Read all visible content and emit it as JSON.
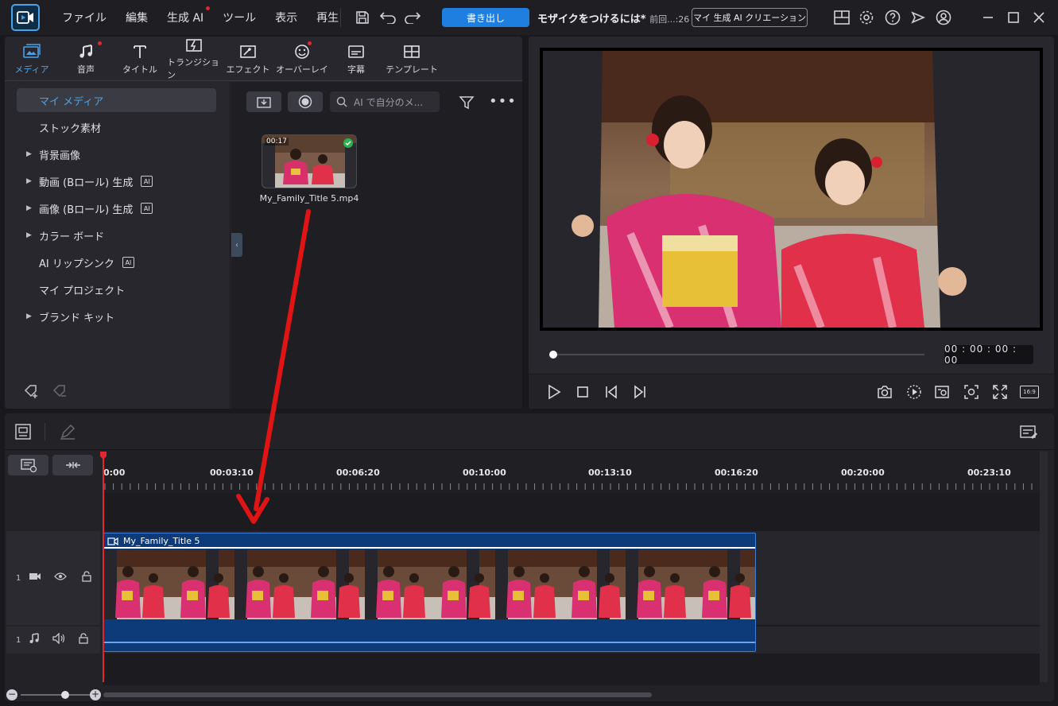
{
  "titlebar": {
    "menu": [
      "ファイル",
      "編集",
      "生成 AI",
      "ツール",
      "表示",
      "再生"
    ],
    "export_label": "書き出し",
    "project_title": "モザイクをつけるには*",
    "project_suffix": "前回...:26",
    "ai_creation_label": "マイ 生成 AI クリエーション"
  },
  "media_tabs": [
    {
      "label": "メディア",
      "icon": "media-icon"
    },
    {
      "label": "音声",
      "icon": "music-note-icon"
    },
    {
      "label": "タイトル",
      "icon": "title-t-icon"
    },
    {
      "label": "トランジション",
      "icon": "transition-icon"
    },
    {
      "label": "エフェクト",
      "icon": "effect-icon"
    },
    {
      "label": "オーバーレイ",
      "icon": "overlay-icon"
    },
    {
      "label": "字幕",
      "icon": "subtitle-icon"
    },
    {
      "label": "テンプレート",
      "icon": "template-icon"
    }
  ],
  "library": {
    "items": [
      {
        "label": "マイ メディア",
        "arrow": false,
        "ai": false
      },
      {
        "label": "ストック素材",
        "arrow": false,
        "ai": false
      },
      {
        "label": "背景画像",
        "arrow": true,
        "ai": false
      },
      {
        "label": "動画 (Bロール) 生成",
        "arrow": true,
        "ai": true
      },
      {
        "label": "画像 (Bロール) 生成",
        "arrow": true,
        "ai": true
      },
      {
        "label": "カラー ボード",
        "arrow": true,
        "ai": false
      },
      {
        "label": "AI リップシンク",
        "arrow": false,
        "ai": true
      },
      {
        "label": "マイ プロジェクト",
        "arrow": false,
        "ai": false
      },
      {
        "label": "ブランド キット",
        "arrow": true,
        "ai": false
      }
    ],
    "ai_badge_text": "AI"
  },
  "media": {
    "search_placeholder": "AI で自分のメ...",
    "clip": {
      "duration": "00:17",
      "name": "My_Family_Title 5.mp4"
    }
  },
  "preview": {
    "timecode": "00 : 00 : 00 : 00",
    "aspect_label": "16:9",
    "progress": 0
  },
  "timeline": {
    "ticks": [
      "0:00",
      "00:03:10",
      "00:06:20",
      "00:10:00",
      "00:13:10",
      "00:16:20",
      "00:20:00",
      "00:23:10"
    ],
    "tracks": [
      {
        "number": "1",
        "type": "video"
      },
      {
        "number": "1",
        "type": "audio"
      }
    ],
    "clip_title": "My_Family_Title 5"
  },
  "colors": {
    "accent": "#1f7fe0",
    "clip": "#0d3a78",
    "playhead": "#e0262e",
    "arrow": "#e01414"
  }
}
